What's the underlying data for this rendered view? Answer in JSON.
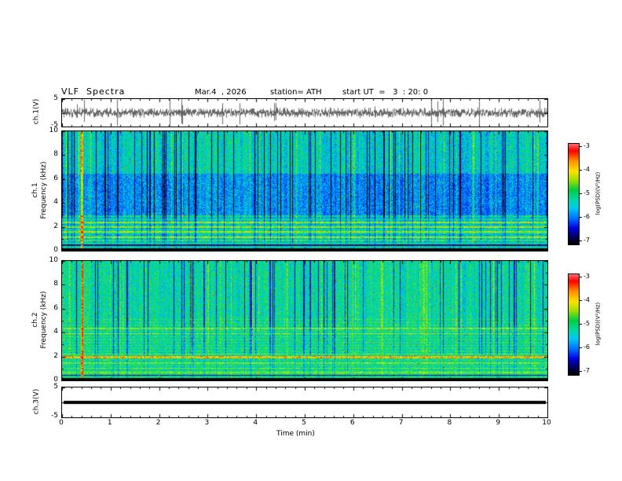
{
  "header": {
    "title": "VLF  Spectra",
    "date": "Mar.4  , 2026",
    "station": "station= ATH",
    "start_ut": "start UT  =   3  : 20: 0"
  },
  "x_axis": {
    "label": "Time  (min)",
    "ticks": [
      "0",
      "1",
      "2",
      "3",
      "4",
      "5",
      "6",
      "7",
      "8",
      "9",
      "10"
    ]
  },
  "panels": {
    "wave1": {
      "ylabel": "ch.1(V)",
      "yticks": [
        "5",
        "-5"
      ]
    },
    "spec1": {
      "ylabel_line1": "ch.1",
      "ylabel_line2": "Frequency  (kHz)",
      "yticks": [
        "10",
        "8",
        "6",
        "4",
        "2",
        "0"
      ]
    },
    "spec2": {
      "ylabel_line1": "ch.2",
      "ylabel_line2": "Frequency  (kHz)",
      "yticks": [
        "10",
        "8",
        "6",
        "4",
        "2",
        "0"
      ]
    },
    "wave3": {
      "ylabel": "ch.3(V)",
      "yticks": [
        "5",
        "-5"
      ]
    }
  },
  "colorbar": {
    "label": "log(PSD)(V²/Hz)",
    "ticks": [
      "-3",
      "-4",
      "-5",
      "-6",
      "-7"
    ]
  },
  "accent_colors": {
    "spectrogram_high": "#ff0000",
    "spectrogram_mid": "#00cc40",
    "spectrogram_low": "#000000"
  },
  "chart_data": [
    {
      "type": "line",
      "title": "ch.1 time series",
      "xlabel": "Time (min)",
      "ylabel": "ch.1(V)",
      "xlim": [
        0,
        10
      ],
      "ylim": [
        -5,
        5
      ],
      "x_ticks": [
        0,
        1,
        2,
        3,
        4,
        5,
        6,
        7,
        8,
        9,
        10
      ],
      "description": "Zero-mean broadband VLF noise, envelope about +/-1 V, with sparse impulsive sferic spikes reaching +/-5 V throughout the 10-minute record"
    },
    {
      "type": "heatmap",
      "title": "ch.1 spectrogram",
      "xlabel": "Time (min)",
      "ylabel": "Frequency (kHz)",
      "xlim": [
        0,
        10
      ],
      "ylim": [
        0,
        10
      ],
      "zlabel": "log(PSD)(V²/Hz)",
      "zlim": [
        -7,
        -3
      ],
      "features": [
        "dense vertical impulsive streaks (sferics) spanning 0-10 kHz for the whole record",
        "reduced PSD band (blue, about -6) between roughly 3 and 6.5 kHz",
        "narrowband horizontal lines (yellow/red, about -4) below roughly 2.5 kHz",
        "broadband transient (red column) near t = 0.4 min",
        "black band (about -7) below roughly 0.3 kHz"
      ]
    },
    {
      "type": "heatmap",
      "title": "ch.2 spectrogram",
      "xlabel": "Time (min)",
      "ylabel": "Frequency (kHz)",
      "xlim": [
        0,
        10
      ],
      "ylim": [
        0,
        10
      ],
      "zlabel": "log(PSD)(V²/Hz)",
      "zlim": [
        -7,
        -3
      ],
      "features": [
        "overall green background (about -5) with vertical sferic streaks",
        "strong narrowband line (red/yellow, about -3.5) near 2 kHz across the whole record",
        "secondary yellow lines near 4 and 4.4 kHz",
        "broadband transient (red column) near t = 0.4 min",
        "black band (about -7) below roughly 0.3 kHz"
      ]
    },
    {
      "type": "line",
      "title": "ch.3 time series",
      "xlabel": "Time (min)",
      "ylabel": "ch.3(V)",
      "xlim": [
        0,
        10
      ],
      "ylim": [
        -5,
        5
      ],
      "description": "Constant 0 V flat thick black line for the entire record (channel inactive)"
    }
  ]
}
